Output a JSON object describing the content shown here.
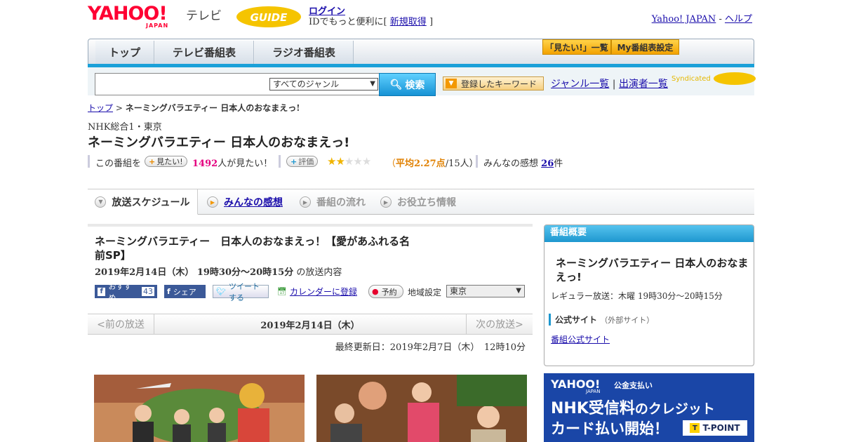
{
  "header": {
    "logo_text": "YAHOO!",
    "logo_sub": "JAPAN",
    "service_name": "テレビ",
    "gguide_logo": "G-GUIDE",
    "login_label": "ログイン",
    "login_sub_prefix": "IDでもっと便利に[",
    "signup_label": "新規取得",
    "login_sub_suffix": "]",
    "yahoo_japan_link": "Yahoo! JAPAN",
    "separator": " - ",
    "help_link": "ヘルプ"
  },
  "nav": {
    "tabs": [
      "トップ",
      "テレビ番組表",
      "ラジオ番組表"
    ],
    "mitai_list": "「見たい!」一覧",
    "my_schedule": "My番組表設定"
  },
  "search": {
    "placeholder": "",
    "genre_selected": "すべてのジャンル",
    "search_button": "検索",
    "keyword_button": "登録したキーワード",
    "genre_list": "ジャンル一覧",
    "divider": "|",
    "performer_list": "出演者一覧",
    "syndicated": "Syndicated"
  },
  "breadcrumb": {
    "home": "トップ",
    "sep": ">",
    "current": "ネーミングバラエティー 日本人のおなまえっ!"
  },
  "program": {
    "channel": "NHK総合1・東京",
    "title": "ネーミングバラエティー 日本人のおなまえっ!",
    "mitai_prefix": "この番組を",
    "mitai_button": "見たい!",
    "mitai_count": "1492",
    "mitai_suffix": "人が見たい！",
    "rate_button": "評価",
    "rating": 2,
    "rating_max": 5,
    "rating_text_open": "（",
    "rating_avg": "平均2.27点",
    "rating_people": "/15人）",
    "comments_label": "みんなの感想",
    "comments_count": "26",
    "comments_suffix": "件"
  },
  "tabs": {
    "schedule": "放送スケジュール",
    "comments": "みんなの感想",
    "flow": "番組の流れ",
    "info": "お役立ち情報"
  },
  "episode": {
    "title": "ネーミングバラエティー　日本人のおなまえっ！【愛があふれる名前SP】",
    "datetime": "2019年2月14日（木） 19時30分～20時15分",
    "datetime_suffix": "の放送内容",
    "recommend_label": "おすすめ",
    "recommend_count": "43",
    "share_label": "シェア",
    "tweet_label": "ツイートする",
    "calendar_label": "カレンダーに登録",
    "reserve_label": "予約",
    "area_label": "地域設定",
    "area_selected": "東京",
    "prev": "<前の放送",
    "current_date": "2019年2月14日（木）",
    "next": "次の放送>",
    "updated": "最終更新日：2019年2月7日（木）　12時10分"
  },
  "overview": {
    "header": "番組概要",
    "title": "ネーミングバラエティー 日本人のおなまえっ!",
    "regular": "レギュラー放送：木曜 19時30分～20時15分",
    "official_label": "公式サイト",
    "official_sub": "（外部サイト）",
    "official_link": "番組公式サイト"
  },
  "ad": {
    "brand": "YAHOO!",
    "brand_sub": "JAPAN",
    "service": "公金支払い",
    "line1_a": "NHK受信料",
    "line1_b": "のクレジット",
    "line2": "カード払い開始！",
    "badge": "T-POINT"
  },
  "colors": {
    "accent_blue": "#1aa0d8",
    "yahoo_red": "#ff0033",
    "pink": "#e4007f"
  }
}
